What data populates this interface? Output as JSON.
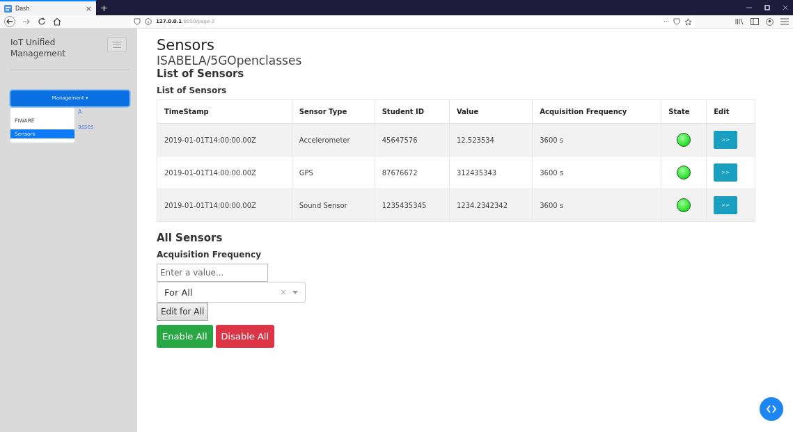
{
  "browser": {
    "tab_title": "Dash",
    "tab_close": "×",
    "new_tab": "+",
    "url_host": "127.0.0.1",
    "url_rest": ":8050/page-2",
    "page_actions": "···"
  },
  "sidebar": {
    "brand": "IoT Unified Management",
    "dropdown_label": "Management ▾",
    "expanded": true,
    "links": [
      "A",
      "asses"
    ],
    "menu_items": [
      {
        "label": "FIWARE",
        "selected": false
      },
      {
        "label": "Sensors",
        "selected": true
      }
    ]
  },
  "page": {
    "title": "Sensors",
    "subtitle": "ISABELA/5GOpenclasses",
    "section_title": "List of Sensors",
    "table_caption": "List of Sensors"
  },
  "table": {
    "columns": [
      "TimeStamp",
      "Sensor Type",
      "Student ID",
      "Value",
      "Acquisition Frequency",
      "State",
      "Edit"
    ],
    "rows": [
      {
        "timestamp": "2019-01-01T14:00:00.00Z",
        "type": "Accelerometer",
        "student_id": "45647576",
        "value": "12.523534",
        "frequency": "3600 s",
        "on": true,
        "edit": ">>"
      },
      {
        "timestamp": "2019-01-01T14:00:00.00Z",
        "type": "GPS",
        "student_id": "87676672",
        "value": "312435343",
        "frequency": "3600 s",
        "on": true,
        "edit": ">>"
      },
      {
        "timestamp": "2019-01-01T14:00:00.00Z",
        "type": "Sound Sensor",
        "student_id": "1235435345",
        "value": "1234.2342342",
        "frequency": "3600 s",
        "on": true,
        "edit": ">>"
      }
    ]
  },
  "all_sensors": {
    "title": "All Sensors",
    "label": "Acquisition Frequency",
    "input_placeholder": "Enter a value...",
    "select_value": "For All",
    "select_clear": "×",
    "edit_button": "Edit for All",
    "enable_button": "Enable All",
    "disable_button": "Disable All"
  }
}
